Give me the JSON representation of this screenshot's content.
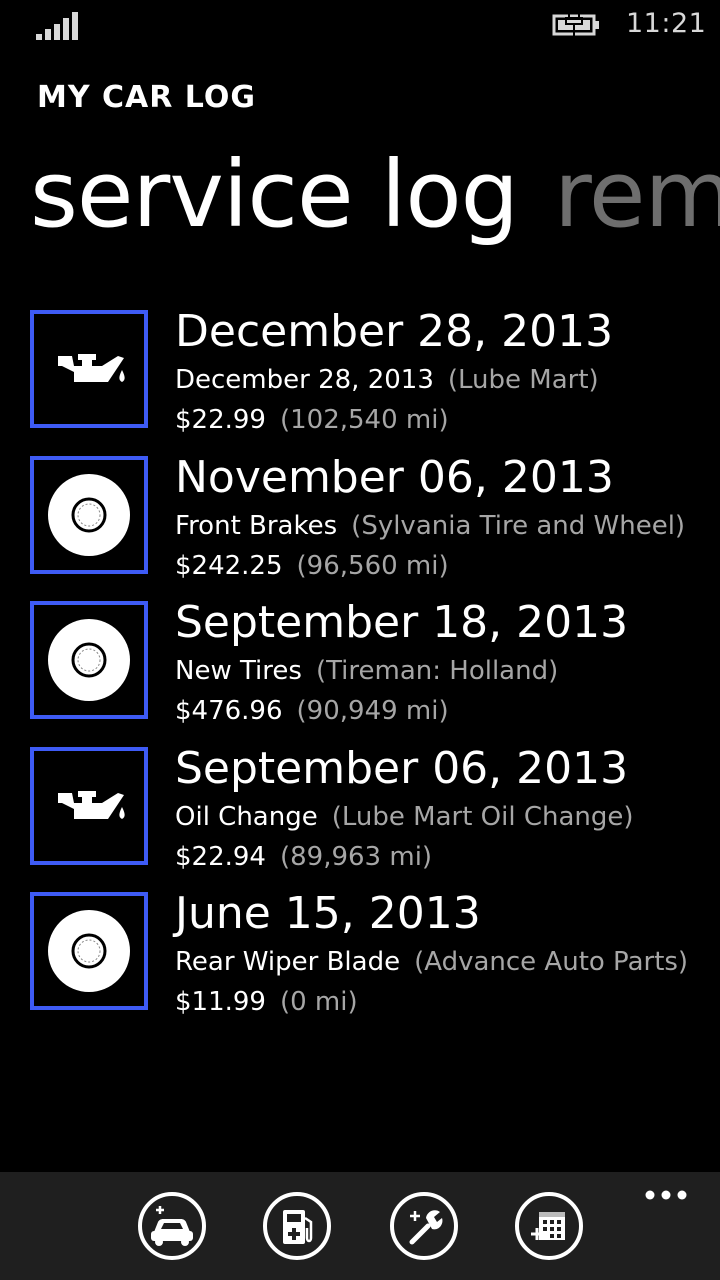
{
  "status": {
    "time": "11:21",
    "signal_icon": "signal-strength-icon",
    "battery_icon": "battery-charging-icon"
  },
  "app": {
    "title": "MY CAR LOG"
  },
  "pivot": {
    "active": "service log",
    "next": "rem"
  },
  "entries": [
    {
      "icon": "oil-can-icon",
      "date": "December 28, 2013",
      "service": "December 28, 2013",
      "vendor": "(Lube Mart)",
      "cost": "$22.99",
      "mileage": "(102,540 mi)"
    },
    {
      "icon": "tire-icon",
      "date": "November 06, 2013",
      "service": "Front Brakes",
      "vendor": "(Sylvania Tire and Wheel)",
      "cost": "$242.25",
      "mileage": "(96,560 mi)"
    },
    {
      "icon": "tire-icon",
      "date": "September 18, 2013",
      "service": "New Tires",
      "vendor": "(Tireman: Holland)",
      "cost": "$476.96",
      "mileage": "(90,949 mi)"
    },
    {
      "icon": "oil-can-icon",
      "date": "September 06, 2013",
      "service": "Oil Change",
      "vendor": "(Lube Mart Oil Change)",
      "cost": "$22.94",
      "mileage": "(89,963 mi)"
    },
    {
      "icon": "tire-icon",
      "date": "June 15, 2013",
      "service": "Rear Wiper Blade",
      "vendor": "(Advance Auto Parts)",
      "cost": "$11.99",
      "mileage": "(0 mi)"
    }
  ],
  "app_bar": {
    "buttons": [
      "add-car-icon",
      "add-fuel-icon",
      "add-service-icon",
      "add-reminder-icon"
    ],
    "more_icon": "more-options-icon"
  },
  "colors": {
    "accent": "#3e5bf5",
    "background": "#000000",
    "app_bar": "#1f1f1f",
    "muted_text": "#a6a6a6"
  }
}
